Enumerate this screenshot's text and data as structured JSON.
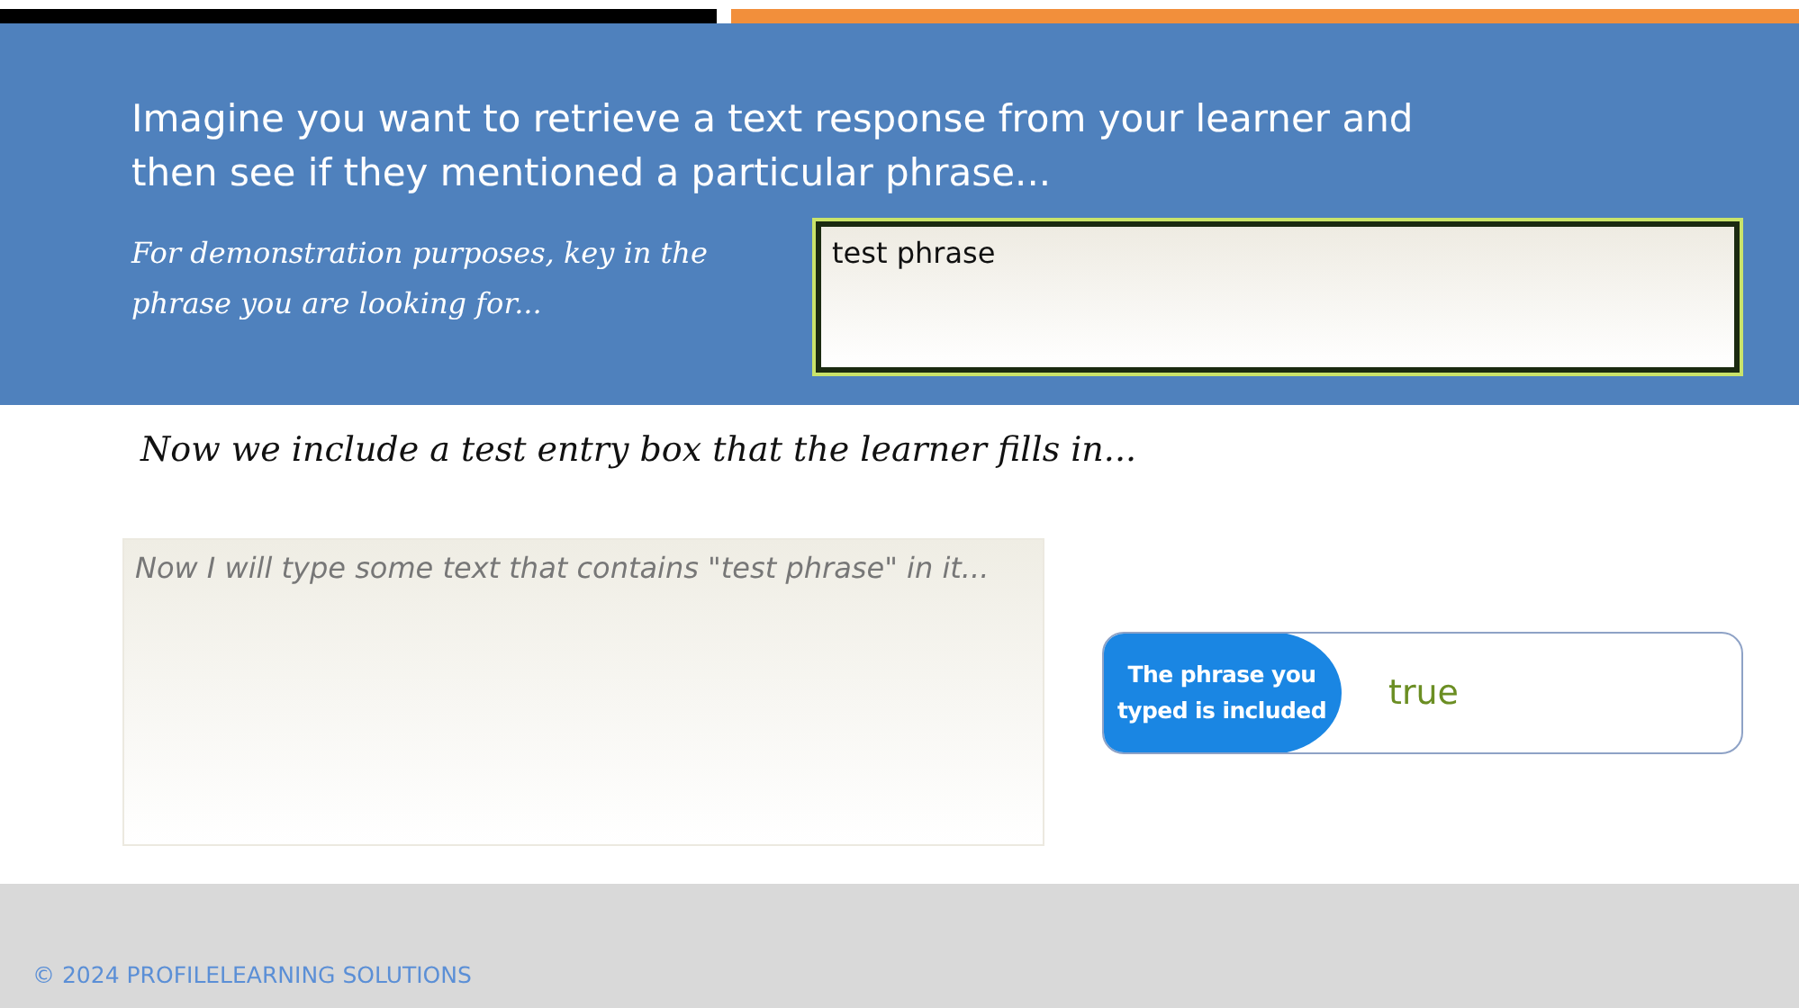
{
  "header": {
    "intro": "Imagine you want to retrieve a text response from your learner and then see if they mentioned a particular phrase...",
    "prompt": "For demonstration purposes, key in the phrase you are looking for...",
    "phrase_field": {
      "value": "test phrase"
    }
  },
  "entry": {
    "instruction": "Now we include a test entry box that the learner fills in...",
    "answer_box": {
      "placeholder": "Now I will type some text that contains \"test phrase\" in it..."
    }
  },
  "result": {
    "label": "The phrase you typed is included",
    "value": "true"
  },
  "footer": {
    "copyright": "© 2024 PROFILELEARNING SOLUTIONS"
  }
}
